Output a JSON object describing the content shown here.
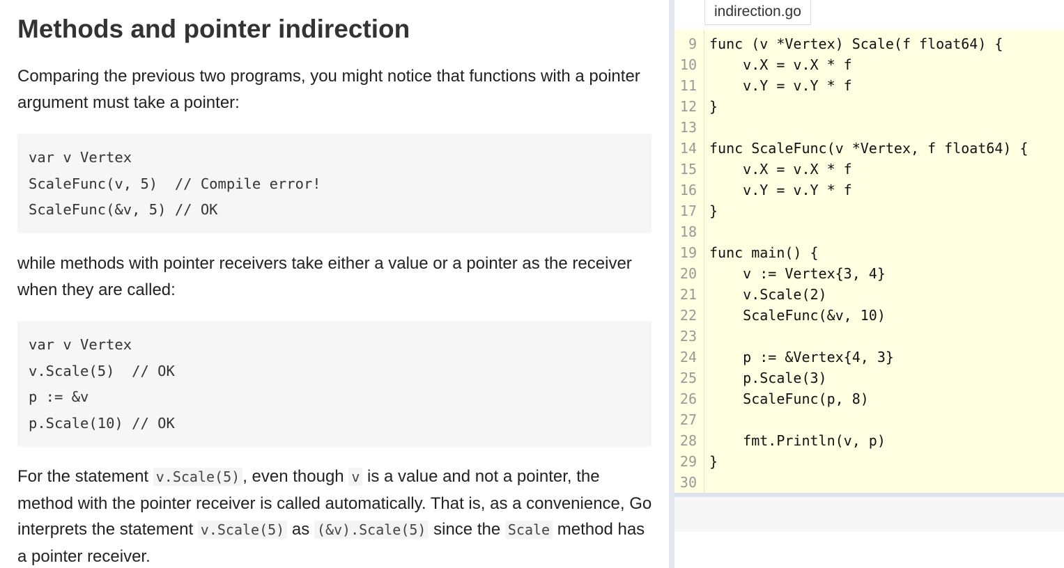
{
  "lesson": {
    "title": "Methods and pointer indirection",
    "p1": "Comparing the previous two programs, you might notice that functions with a pointer argument must take a pointer:",
    "code1": [
      "var v Vertex",
      "ScaleFunc(v, 5)  // Compile error!",
      "ScaleFunc(&v, 5) // OK"
    ],
    "p2": "while methods with pointer receivers take either a value or a pointer as the receiver when they are called:",
    "code2": [
      "var v Vertex",
      "v.Scale(5)  // OK",
      "p := &v",
      "p.Scale(10) // OK"
    ],
    "p3": {
      "t1": "For the statement ",
      "c1": "v.Scale(5)",
      "t2": ", even though ",
      "c2": "v",
      "t3": " is a value and not a pointer, the method with the pointer receiver is called automatically. That is, as a convenience, Go interprets the statement ",
      "c3": "v.Scale(5)",
      "t4": " as ",
      "c4": "(&v).Scale(5)",
      "t5": " since the ",
      "c5": "Scale",
      "t6": " method has a pointer receiver."
    }
  },
  "editor": {
    "filename": "indirection.go",
    "lines": [
      {
        "no": "9",
        "code": "func (v *Vertex) Scale(f float64) {"
      },
      {
        "no": "10",
        "code": "    v.X = v.X * f"
      },
      {
        "no": "11",
        "code": "    v.Y = v.Y * f"
      },
      {
        "no": "12",
        "code": "}"
      },
      {
        "no": "13",
        "code": ""
      },
      {
        "no": "14",
        "code": "func ScaleFunc(v *Vertex, f float64) {"
      },
      {
        "no": "15",
        "code": "    v.X = v.X * f"
      },
      {
        "no": "16",
        "code": "    v.Y = v.Y * f"
      },
      {
        "no": "17",
        "code": "}"
      },
      {
        "no": "18",
        "code": ""
      },
      {
        "no": "19",
        "code": "func main() {"
      },
      {
        "no": "20",
        "code": "    v := Vertex{3, 4}"
      },
      {
        "no": "21",
        "code": "    v.Scale(2)"
      },
      {
        "no": "22",
        "code": "    ScaleFunc(&v, 10)"
      },
      {
        "no": "23",
        "code": ""
      },
      {
        "no": "24",
        "code": "    p := &Vertex{4, 3}"
      },
      {
        "no": "25",
        "code": "    p.Scale(3)"
      },
      {
        "no": "26",
        "code": "    ScaleFunc(p, 8)"
      },
      {
        "no": "27",
        "code": ""
      },
      {
        "no": "28",
        "code": "    fmt.Println(v, p)"
      },
      {
        "no": "29",
        "code": "}"
      },
      {
        "no": "30",
        "code": ""
      }
    ]
  },
  "colors": {
    "editor_background": "#ffffe1",
    "divider": "#e3e8f2",
    "code_block_background": "#f6f6f6",
    "line_number": "#999999"
  }
}
